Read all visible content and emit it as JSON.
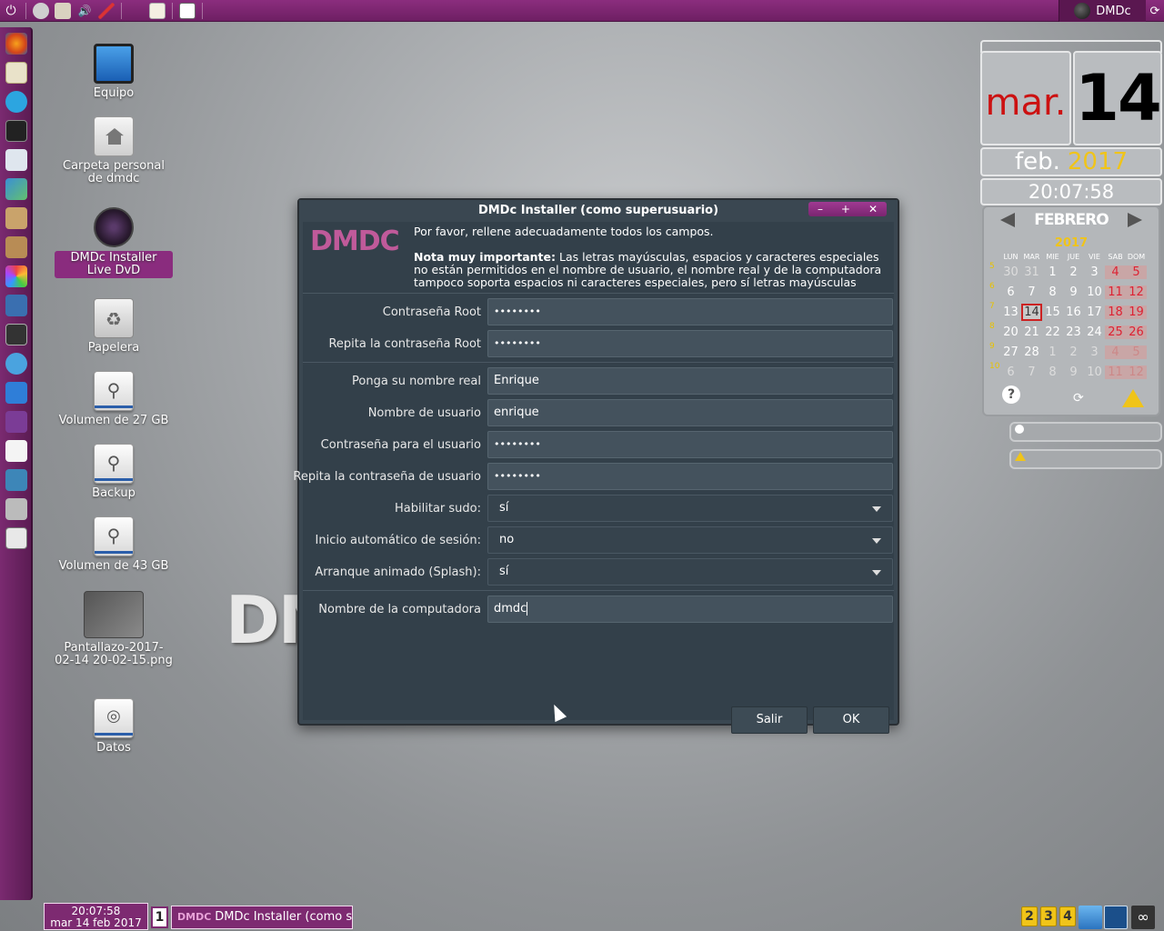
{
  "top_panel": {
    "user_name": "DMDc",
    "power_icon": "power-icon",
    "refresh_icon": "refresh-icon"
  },
  "desktop_icons": [
    {
      "label": "Equipo"
    },
    {
      "label": "Carpeta personal de dmdc"
    },
    {
      "label": "DMDc Installer Live DvD"
    },
    {
      "label": "Papelera"
    },
    {
      "label": "Volumen de 27 GB"
    },
    {
      "label": "Backup"
    },
    {
      "label": "Volumen de 43 GB"
    },
    {
      "label": "Pantallazo-2017-02-14 20-02-15.png"
    },
    {
      "label": "Datos"
    }
  ],
  "background_text": "DM",
  "calendar": {
    "weekday": "mar.",
    "day": "14",
    "month": "feb.",
    "year": "2017",
    "time": "20:07:58",
    "month_title": "FEBRERO",
    "grid_year": "2017",
    "day_headers": [
      "LUN",
      "MAR",
      "MIE",
      "JUE",
      "VIE",
      "SAB",
      "DOM"
    ],
    "weeks": [
      {
        "wk": "5",
        "days": [
          "30",
          "31",
          "1",
          "2",
          "3",
          "4",
          "5"
        ]
      },
      {
        "wk": "6",
        "days": [
          "6",
          "7",
          "8",
          "9",
          "10",
          "11",
          "12"
        ]
      },
      {
        "wk": "7",
        "days": [
          "13",
          "14",
          "15",
          "16",
          "17",
          "18",
          "19"
        ]
      },
      {
        "wk": "8",
        "days": [
          "20",
          "21",
          "22",
          "23",
          "24",
          "25",
          "26"
        ]
      },
      {
        "wk": "9",
        "days": [
          "27",
          "28",
          "1",
          "2",
          "3",
          "4",
          "5"
        ]
      },
      {
        "wk": "10",
        "days": [
          "6",
          "7",
          "8",
          "9",
          "10",
          "11",
          "12"
        ]
      }
    ]
  },
  "dialog": {
    "title": "DMDc Installer (como superusuario)",
    "logo": "DMDC",
    "intro_line1": "Por favor, rellene adecuadamente todos los campos.",
    "note_bold": "Nota muy importante:",
    "note_text": " Las letras mayúsculas, espacios y caracteres especiales no están permitidos en el nombre de usuario, el nombre real y de la computadora tampoco soporta espacios ni caracteres especiales, pero sí letras mayúsculas",
    "fields": {
      "root_pw_label": "Contraseña Root",
      "root_pw_value": "••••••••",
      "root_pw2_label": "Repita la contraseña Root",
      "root_pw2_value": "••••••••",
      "realname_label": "Ponga su nombre real",
      "realname_value": "Enrique",
      "username_label": "Nombre de usuario",
      "username_value": "enrique",
      "user_pw_label": "Contraseña para el usuario",
      "user_pw_value": "••••••••",
      "user_pw2_label": "Repita la contraseña de usuario",
      "user_pw2_value": "••••••••",
      "sudo_label": "Habilitar sudo:",
      "sudo_value": "sí",
      "autologin_label": "Inicio automático de sesión:",
      "autologin_value": "no",
      "splash_label": "Arranque animado (Splash):",
      "splash_value": "sí",
      "hostname_label": "Nombre de la computadora",
      "hostname_value": "dmdc"
    },
    "buttons": {
      "quit": "Salir",
      "ok": "OK"
    }
  },
  "bottom_panel": {
    "clock_time": "20:07:58",
    "clock_date": "mar 14 feb 2017",
    "workspace": "1",
    "task_logo": "DMDC",
    "task_label": "DMDc Installer (como su...",
    "workspaces": [
      "2",
      "3",
      "4"
    ]
  }
}
